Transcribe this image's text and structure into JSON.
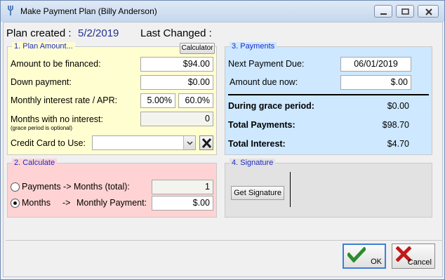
{
  "window": {
    "title": "Make Payment Plan (Billy Anderson)",
    "icon": "fork-icon"
  },
  "header": {
    "plan_created_label": "Plan created :",
    "plan_created_value": "5/2/2019",
    "last_changed_label": "Last Changed :",
    "last_changed_value": ""
  },
  "plan_amount": {
    "title": "1. Plan Amount...",
    "calculator_button": "Calculator",
    "amount_financed_label": "Amount to be financed:",
    "amount_financed_value": "$94.00",
    "down_payment_label": "Down payment:",
    "down_payment_value": "$0.00",
    "interest_label": "Monthly interest rate / APR:",
    "monthly_rate_value": "5.00%",
    "apr_value": "60.0%",
    "no_interest_label": "Months with no interest:",
    "no_interest_sublabel": "(grace period is optional)",
    "no_interest_value": "0",
    "credit_card_label": "Credit Card to Use:",
    "credit_card_value": ""
  },
  "payments": {
    "title": "3. Payments",
    "next_payment_label": "Next Payment Due:",
    "next_payment_value": "06/01/2019",
    "amount_due_label": "Amount due now:",
    "amount_due_value": "$.00",
    "grace_period_label": "During grace period:",
    "grace_period_value": "$0.00",
    "total_payments_label": "Total Payments:",
    "total_payments_value": "$98.70",
    "total_interest_label": "Total Interest:",
    "total_interest_value": "$4.70"
  },
  "calculate": {
    "title": "2. Calculate",
    "option_payments_label": "Payments -> Months (total):",
    "option_payments_value": "1",
    "option_months_label": "Months",
    "option_months_arrow": "->",
    "option_months_target": "Monthly Payment:",
    "option_months_value": "$.00",
    "selected": "months"
  },
  "signature": {
    "title": "4. Signature",
    "get_signature_button": "Get Signature"
  },
  "footer": {
    "ok_label": "OK",
    "cancel_label": "Cancel"
  },
  "colors": {
    "plan_bg": "#fffed0",
    "payments_bg": "#cde8ff",
    "calculate_bg": "#ffd3d3",
    "signature_bg": "#e2e2e2",
    "group_title": "#1d2bc7",
    "date_value": "#1f2f95"
  }
}
